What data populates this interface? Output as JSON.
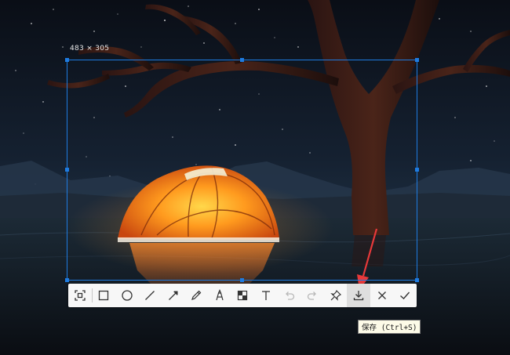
{
  "selection": {
    "size_label": "483 × 305"
  },
  "toolbar": {
    "tools": [
      {
        "name": "ocr-capture-tool"
      },
      {
        "name": "rectangle-tool"
      },
      {
        "name": "ellipse-tool"
      },
      {
        "name": "line-tool"
      },
      {
        "name": "arrow-tool"
      },
      {
        "name": "pen-tool"
      },
      {
        "name": "marker-tool"
      },
      {
        "name": "mosaic-tool"
      },
      {
        "name": "text-tool"
      },
      {
        "name": "undo-button"
      },
      {
        "name": "redo-button"
      },
      {
        "name": "pin-button"
      },
      {
        "name": "save-button",
        "active": true
      },
      {
        "name": "cancel-button"
      },
      {
        "name": "confirm-button"
      }
    ]
  },
  "tooltip": {
    "text": "保存 (Ctrl+S)"
  },
  "colors": {
    "accent": "#1e7be0",
    "annotation_arrow": "#e8393a"
  }
}
